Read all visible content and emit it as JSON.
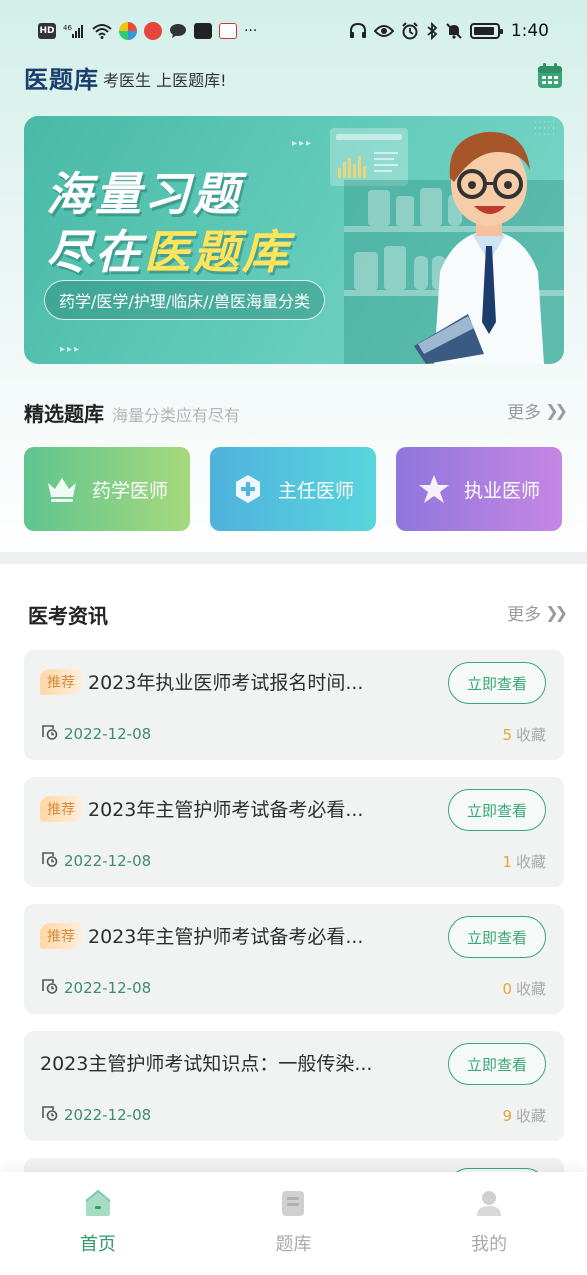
{
  "status_bar": {
    "left_icons": [
      "hd-icon",
      "signal-4g-icon",
      "wifi-icon",
      "app-icon",
      "weibo-icon",
      "chat-icon",
      "app-icon",
      "app-icon"
    ],
    "more": "···",
    "time": "1:40"
  },
  "header": {
    "logo": "医题库",
    "slogan": "考医生 上医题库!"
  },
  "banner": {
    "line1": "海量习题",
    "line2_prefix": "尽在",
    "line2_highlight": "医题库",
    "pill": "药学/医学/护理/临床//兽医海量分类"
  },
  "featured": {
    "title": "精选题库",
    "subtitle": "海量分类应有尽有",
    "more": "更多",
    "categories": [
      {
        "label": "药学医师",
        "icon": "crown-icon"
      },
      {
        "label": "主任医师",
        "icon": "plus-icon"
      },
      {
        "label": "执业医师",
        "icon": "star-icon"
      }
    ]
  },
  "news": {
    "title": "医考资讯",
    "more": "更多",
    "button_label": "立即查看",
    "fav_label": "收藏",
    "items": [
      {
        "tag": "推荐",
        "title": "2023年执业医师考试报名时间...",
        "date": "2022-12-08",
        "favs": "5"
      },
      {
        "tag": "推荐",
        "title": "2023年主管护师考试备考必看...",
        "date": "2022-12-08",
        "favs": "1"
      },
      {
        "tag": "推荐",
        "title": "2023年主管护师考试备考必看...",
        "date": "2022-12-08",
        "favs": "0"
      },
      {
        "tag": "",
        "title": "2023主管护师考试知识点：一般传染...",
        "date": "2022-12-08",
        "favs": "9"
      }
    ]
  },
  "nav": {
    "items": [
      {
        "label": "首页",
        "icon": "home-icon",
        "active": true
      },
      {
        "label": "题库",
        "icon": "question-bank-icon",
        "active": false
      },
      {
        "label": "我的",
        "icon": "profile-icon",
        "active": false
      }
    ]
  },
  "colors": {
    "accent": "#3aa678",
    "logo": "#1a3e6e",
    "banner": "#5fc9b8",
    "tag": "#d98a3a",
    "fav_number": "#e3a73a"
  }
}
